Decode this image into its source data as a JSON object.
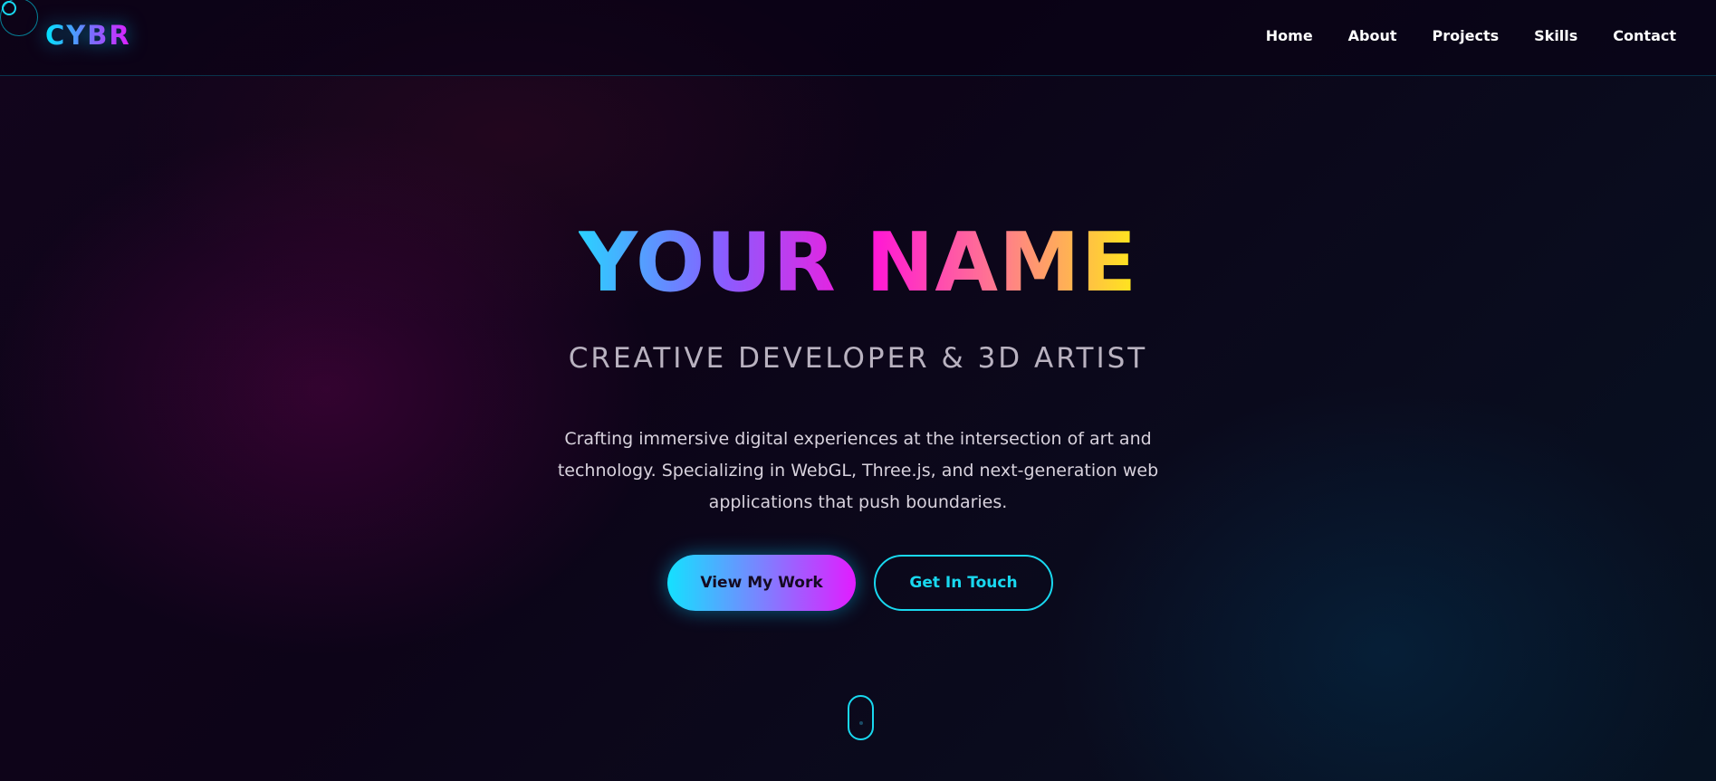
{
  "brand": {
    "logo_text": "CYBR"
  },
  "nav": {
    "items": [
      {
        "label": "Home"
      },
      {
        "label": "About"
      },
      {
        "label": "Projects"
      },
      {
        "label": "Skills"
      },
      {
        "label": "Contact"
      }
    ]
  },
  "hero": {
    "title": "YOUR NAME",
    "subtitle": "CREATIVE DEVELOPER & 3D ARTIST",
    "description_lines": [
      "Crafting immersive digital experiences at the intersection of art and",
      "technology. Specializing in WebGL, Three.js, and next-generation web",
      "applications that push boundaries."
    ],
    "primary_button": "View My Work",
    "secondary_button": "Get In Touch"
  },
  "colors": {
    "accent_cyan": "#19d8ef",
    "accent_magenta": "#e21cff",
    "accent_yellow": "#ffe81a",
    "background": "#0a0614"
  },
  "icons": {
    "cursor": "cursor-ring-icon",
    "scroll": "scroll-mouse-icon"
  }
}
